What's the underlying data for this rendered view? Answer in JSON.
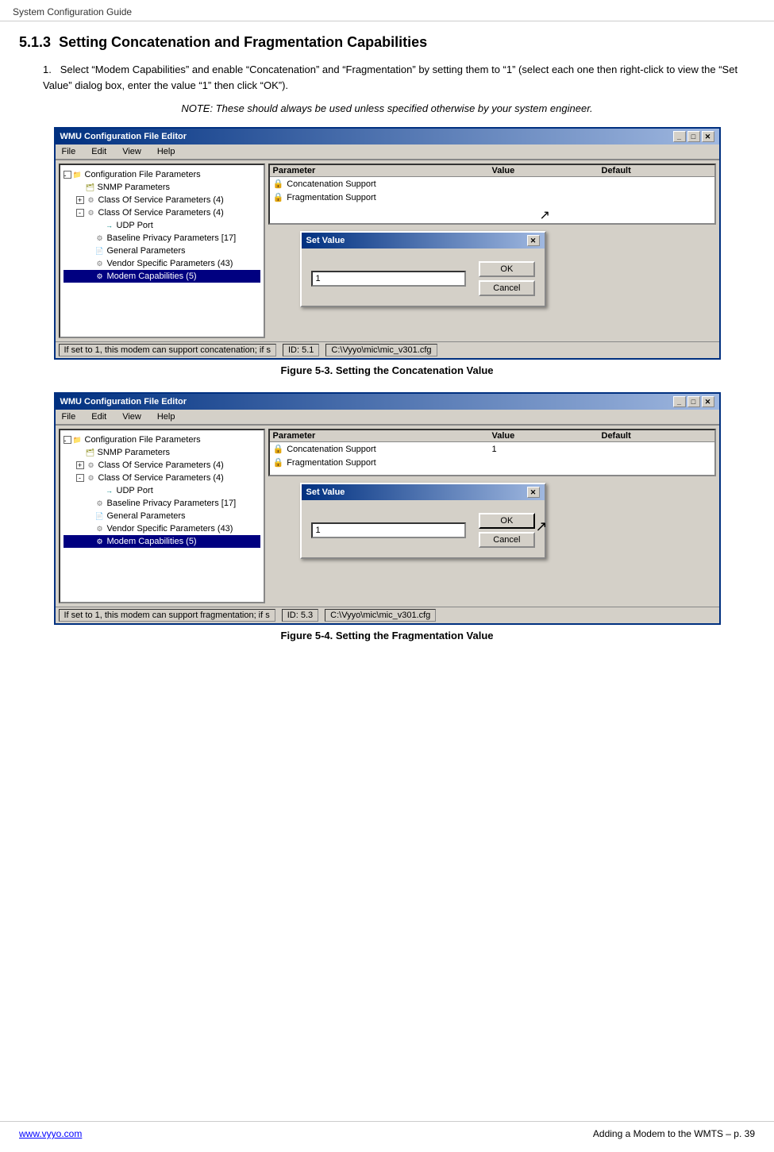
{
  "header": {
    "title": "System Configuration Guide"
  },
  "section": {
    "number": "5.1.3",
    "title": "Setting Concatenation and Fragmentation Capabilities",
    "step1": "Select “Modem Capabilities” and enable “Concatenation” and “Fragmentation” by setting them to “1” (select each one then right-click to view the “Set Value” dialog box, enter the value “1” then click “OK”).",
    "note": "NOTE: These should always be used unless specified otherwise by your system engineer.",
    "figure3_caption": "Figure 5-3. Setting the Concatenation Value",
    "figure4_caption": "Figure 5-4. Setting the Fragmentation Value"
  },
  "window": {
    "title": "WMU Configuration File Editor",
    "menu": [
      "File",
      "Edit",
      "View",
      "Help"
    ],
    "tree": {
      "root": "Configuration File Parameters",
      "items": [
        {
          "label": "SNMP Parameters",
          "indent": 1,
          "icon": "folder",
          "expand": ""
        },
        {
          "label": "Class Of Service Parameters (4)",
          "indent": 1,
          "icon": "gear",
          "expand": "+"
        },
        {
          "label": "Class Of Service Parameters (4)",
          "indent": 1,
          "icon": "gear",
          "expand": "-"
        },
        {
          "label": "UDP Port",
          "indent": 3,
          "icon": "arrow",
          "expand": ""
        },
        {
          "label": "Baseline Privacy Parameters [17]",
          "indent": 2,
          "icon": "gear",
          "expand": ""
        },
        {
          "label": "General Parameters",
          "indent": 2,
          "icon": "doc",
          "expand": ""
        },
        {
          "label": "Vendor Specific Parameters (43)",
          "indent": 2,
          "icon": "gear",
          "expand": ""
        },
        {
          "label": "Modem Capabilities (5)",
          "indent": 2,
          "icon": "gear",
          "expand": "",
          "selected": true
        }
      ]
    },
    "params": {
      "headers": [
        "Parameter",
        "Value",
        "Default"
      ],
      "rows": [
        {
          "param": "Concatenation Support",
          "value": "",
          "default": ""
        },
        {
          "param": "Fragmentation Support",
          "value": "",
          "default": ""
        }
      ]
    },
    "statusbar": {
      "left": "If set to 1, this modem can support concatenation; if s",
      "mid": "ID: 5.1",
      "right": "C:\\Vyyo\\mic\\mic_v301.cfg"
    },
    "dialog": {
      "title": "Set Value",
      "input_value": "1 |",
      "ok_label": "OK",
      "cancel_label": "Cancel"
    }
  },
  "window2": {
    "title": "WMU Configuration File Editor",
    "menu": [
      "File",
      "Edit",
      "View",
      "Help"
    ],
    "params": {
      "rows": [
        {
          "param": "Concatenation Support",
          "value": "1",
          "default": ""
        },
        {
          "param": "Fragmentation Support",
          "value": "",
          "default": ""
        }
      ]
    },
    "statusbar": {
      "left": "If set to 1, this modem can support fragmentation; if s",
      "mid": "ID: 5.3",
      "right": "C:\\Vyyo\\mic\\mic_v301.cfg"
    },
    "dialog": {
      "title": "Set Value",
      "input_value": "1|",
      "ok_label": "OK",
      "cancel_label": "Cancel"
    }
  },
  "footer": {
    "left": "www.vyyo.com",
    "right": "Adding a Modem to the WMTS – p. 39"
  }
}
